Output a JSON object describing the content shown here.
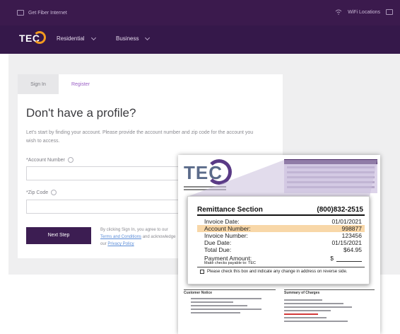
{
  "utility_bar": {
    "left_text": "Get Fiber Internet",
    "right_text": "WiFi Locations"
  },
  "nav": {
    "logo": "TEC",
    "items": [
      {
        "label": "Residential"
      },
      {
        "label": "Business"
      }
    ]
  },
  "tabs": {
    "signin": "Sign In",
    "register": "Register"
  },
  "form": {
    "title": "Don't have a profile?",
    "description": "Let's start by finding your account. Please provide the account number and zip code for the account you wish to access.",
    "account_label": "*Account Number",
    "zip_label": "*Zip Code",
    "next_button": "Next Step",
    "terms_prefix": "By clicking Sign In, you agree to our",
    "terms_link": "Terms and Conditions",
    "terms_mid": "and acknowledge our",
    "privacy_link": "Privacy Policy"
  },
  "bill": {
    "logo": "TEC",
    "customer_notice": "Customer Notice",
    "summary_title": "Summary of Charges"
  },
  "remittance": {
    "title": "Remittance Section",
    "phone": "(800)832-2515",
    "rows": [
      {
        "label": "Invoice Date:",
        "value": "01/01/2021",
        "highlight": false
      },
      {
        "label": "Account Number:",
        "value": "998877",
        "highlight": true
      },
      {
        "label": "Invoice Number:",
        "value": "123456",
        "highlight": false
      },
      {
        "label": "Due Date:",
        "value": "01/15/2021",
        "highlight": false
      },
      {
        "label": "Total Due:",
        "value": "$64.95",
        "highlight": false
      }
    ],
    "payment_label": "Payment Amount:",
    "payment_currency": "$",
    "payable_note": "Make checks payable to: TEC",
    "check_note": "Please check this box and indicate any change in address on reverse side."
  },
  "colors": {
    "brand_purple": "#35184a",
    "accent_orange": "#f39a1f",
    "highlight": "#f8d7a8"
  }
}
